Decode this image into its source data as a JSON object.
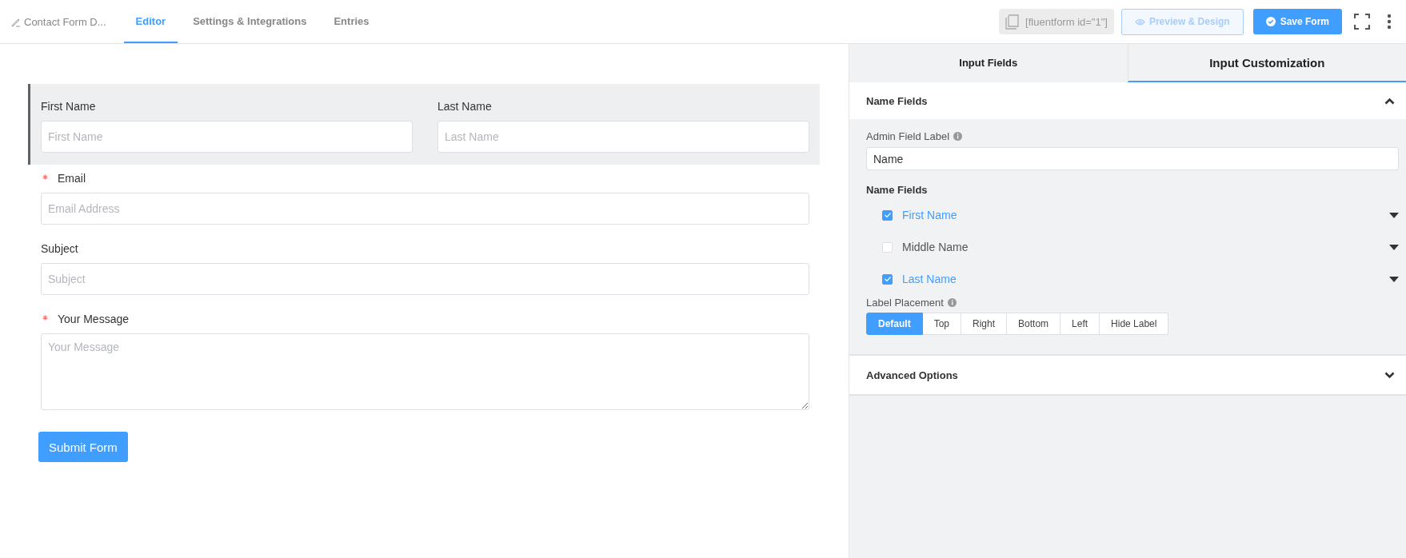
{
  "header": {
    "form_title": "Contact Form D...",
    "tabs": [
      {
        "label": "Editor",
        "selected": true
      },
      {
        "label": "Settings & Integrations",
        "selected": false
      },
      {
        "label": "Entries",
        "selected": false
      }
    ],
    "shortcode": "[fluentform id=\"1\"]",
    "preview_button": "Preview & Design",
    "save_button": "Save Form"
  },
  "form": {
    "fields": [
      {
        "kind": "name",
        "selected": true,
        "parts": [
          {
            "label": "First Name",
            "placeholder": "First Name"
          },
          {
            "label": "Last Name",
            "placeholder": "Last Name"
          }
        ]
      },
      {
        "kind": "input",
        "selected": false,
        "required": true,
        "label": "Email",
        "placeholder": "Email Address"
      },
      {
        "kind": "input",
        "selected": false,
        "required": false,
        "label": "Subject",
        "placeholder": "Subject"
      },
      {
        "kind": "textarea",
        "selected": false,
        "required": true,
        "label": "Your Message",
        "placeholder": "Your Message"
      }
    ],
    "submit_button": "Submit Form"
  },
  "panel": {
    "tabs": [
      {
        "label": "Input Fields",
        "selected": false
      },
      {
        "label": "Input Customization",
        "selected": true
      }
    ],
    "name_section": {
      "title": "Name Fields",
      "expanded": true,
      "admin_label": "Admin Field Label",
      "admin_value": "Name",
      "name_fields_title": "Name Fields",
      "name_fields": [
        {
          "label": "First Name",
          "checked": true
        },
        {
          "label": "Middle Name",
          "checked": false
        },
        {
          "label": "Last Name",
          "checked": true
        }
      ],
      "placement_label": "Label Placement",
      "placement_options": [
        {
          "label": "Default",
          "selected": true
        },
        {
          "label": "Top",
          "selected": false
        },
        {
          "label": "Right",
          "selected": false
        },
        {
          "label": "Bottom",
          "selected": false
        },
        {
          "label": "Left",
          "selected": false
        },
        {
          "label": "Hide Label",
          "selected": false
        }
      ]
    },
    "advanced_section": {
      "title": "Advanced Options",
      "expanded": false
    }
  }
}
